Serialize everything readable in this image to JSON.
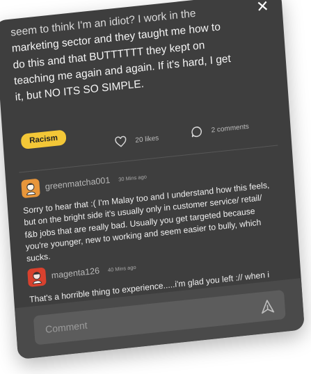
{
  "post": {
    "text_lines": [
      "seem to think I'm an idiot? I work in the",
      "marketing sector and they taught me how to",
      "do this and that BUTTTTTT they kept on",
      "teaching me again and again. If it's hard, I get",
      "it, but NO ITS SO SIMPLE."
    ],
    "tag": "Racism",
    "likes_label": "20 likes",
    "comments_label": "2 comments"
  },
  "comments": [
    {
      "username": "greenmatcha001",
      "time": "30 Mins ago",
      "body": "Sorry to hear that :( I'm Malay too and I understand how this feels, but on the bright side it's usually only in customer service/ retail/ f&b jobs that are really bad. Usually you get targeted because you're younger, new to working and seem easier to bully, which sucks."
    },
    {
      "username": "magenta126",
      "time": "40 Mins ago",
      "body": "That's a horrible thing to experience.....i'm glad you left :// when i got my first job too i was shocked at the sheer racism there was against minorities & its rlly sad how it's so widely experienced by many in the work force."
    }
  ],
  "composer": {
    "placeholder": "Comment"
  },
  "icons": {
    "close": "close-icon",
    "like": "heart-icon",
    "comments": "speech-bubble-icon",
    "send": "send-icon"
  },
  "colors": {
    "card_bg": "#3e3e3e",
    "tag_bg": "#f3c737",
    "avatar_1": "#e8963a",
    "avatar_2": "#d8412e"
  }
}
